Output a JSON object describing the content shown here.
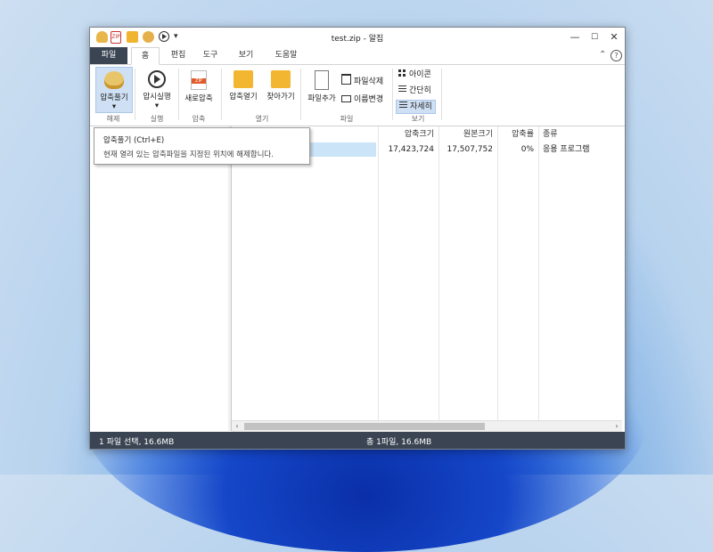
{
  "window": {
    "title": "test.zip - 알집",
    "minimize": "—",
    "maximize": "☐",
    "close": "✕",
    "quick_more": "▾"
  },
  "tabs": {
    "file": "파일",
    "home": "홈",
    "edit": "편집",
    "tools": "도구",
    "view": "보기",
    "help": "도움말",
    "collapse": "⌃",
    "help_icon": "?"
  },
  "ribbon": {
    "extract": "압축풀기",
    "extract_arrow": "▾",
    "run": "압시실행",
    "run_arrow": "▾",
    "new_compress": "새로압축",
    "open_compressed": "압축열기",
    "goto": "찾아가기",
    "add_file": "파일추가",
    "delete_file": "파일삭제",
    "rename": "이름변경",
    "view_icons": "아이콘",
    "view_simple": "간단히",
    "view_detail": "자세히",
    "groups": {
      "extract": "해제",
      "run": "실행",
      "compress": "압축",
      "open": "열기",
      "file": "파일",
      "view": "보기"
    }
  },
  "tooltip": {
    "title": "압축풀기 (Ctrl+E)",
    "description": "현재 열려 있는 압축파일을 지정된 위치에 해제합니다."
  },
  "file_list": {
    "columns": [
      "압축크기",
      "원본크기",
      "압축률",
      "종류"
    ],
    "rows": [
      {
        "compressed": "17,423,724",
        "original": "17,507,752",
        "ratio": "0%",
        "type": "응용 프로그램"
      }
    ]
  },
  "status": {
    "selected": "1 파일 선택, 16.6MB",
    "total": "총 1파일, 16.6MB"
  },
  "icons": {
    "scroll_left": "‹",
    "scroll_right": "›"
  }
}
